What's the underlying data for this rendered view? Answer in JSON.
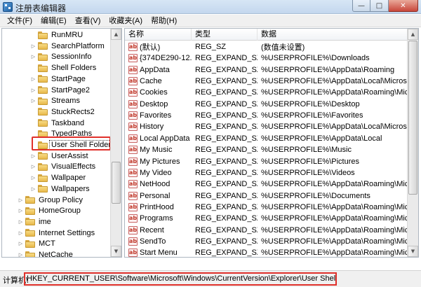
{
  "window": {
    "title": "注册表编辑器",
    "min_symbol": "—",
    "max_symbol": "□",
    "close_symbol": "✕"
  },
  "menu": [
    "文件(F)",
    "编辑(E)",
    "查看(V)",
    "收藏夹(A)",
    "帮助(H)"
  ],
  "tree": {
    "selected": "User Shell Folders",
    "items": [
      {
        "label": "RunMRU",
        "level": 2,
        "expander": false
      },
      {
        "label": "SearchPlatform",
        "level": 2,
        "expander": true
      },
      {
        "label": "SessionInfo",
        "level": 2,
        "expander": true
      },
      {
        "label": "Shell Folders",
        "level": 2,
        "expander": false
      },
      {
        "label": "StartPage",
        "level": 2,
        "expander": true
      },
      {
        "label": "StartPage2",
        "level": 2,
        "expander": true
      },
      {
        "label": "Streams",
        "level": 2,
        "expander": true
      },
      {
        "label": "StuckRects2",
        "level": 2,
        "expander": false
      },
      {
        "label": "Taskband",
        "level": 2,
        "expander": false
      },
      {
        "label": "TypedPaths",
        "level": 2,
        "expander": false
      },
      {
        "label": "User Shell Folders",
        "level": 2,
        "expander": false
      },
      {
        "label": "UserAssist",
        "level": 2,
        "expander": true
      },
      {
        "label": "VisualEffects",
        "level": 2,
        "expander": true
      },
      {
        "label": "Wallpaper",
        "level": 2,
        "expander": true
      },
      {
        "label": "Wallpapers",
        "level": 2,
        "expander": true
      },
      {
        "label": "Group Policy",
        "level": 1,
        "expander": true
      },
      {
        "label": "HomeGroup",
        "level": 1,
        "expander": true
      },
      {
        "label": "ime",
        "level": 1,
        "expander": true
      },
      {
        "label": "Internet Settings",
        "level": 1,
        "expander": true
      },
      {
        "label": "MCT",
        "level": 1,
        "expander": true
      },
      {
        "label": "NetCache",
        "level": 1,
        "expander": true
      }
    ]
  },
  "values": {
    "headers": {
      "name": "名称",
      "type": "类型",
      "data": "数据"
    },
    "rows": [
      {
        "name": "(默认)",
        "type": "REG_SZ",
        "data": "(数值未设置)"
      },
      {
        "name": "{374DE290-12...",
        "type": "REG_EXPAND_SZ",
        "data": "%USERPROFILE%\\Downloads"
      },
      {
        "name": "AppData",
        "type": "REG_EXPAND_SZ",
        "data": "%USERPROFILE%\\AppData\\Roaming"
      },
      {
        "name": "Cache",
        "type": "REG_EXPAND_SZ",
        "data": "%USERPROFILE%\\AppData\\Local\\Microsoft\\"
      },
      {
        "name": "Cookies",
        "type": "REG_EXPAND_SZ",
        "data": "%USERPROFILE%\\AppData\\Roaming\\Microsoft"
      },
      {
        "name": "Desktop",
        "type": "REG_EXPAND_SZ",
        "data": "%USERPROFILE%\\Desktop"
      },
      {
        "name": "Favorites",
        "type": "REG_EXPAND_SZ",
        "data": "%USERPROFILE%\\Favorites"
      },
      {
        "name": "History",
        "type": "REG_EXPAND_SZ",
        "data": "%USERPROFILE%\\AppData\\Local\\Microsoft\\"
      },
      {
        "name": "Local AppData",
        "type": "REG_EXPAND_SZ",
        "data": "%USERPROFILE%\\AppData\\Local"
      },
      {
        "name": "My Music",
        "type": "REG_EXPAND_SZ",
        "data": "%USERPROFILE%\\Music"
      },
      {
        "name": "My Pictures",
        "type": "REG_EXPAND_SZ",
        "data": "%USERPROFILE%\\Pictures"
      },
      {
        "name": "My Video",
        "type": "REG_EXPAND_SZ",
        "data": "%USERPROFILE%\\Videos"
      },
      {
        "name": "NetHood",
        "type": "REG_EXPAND_SZ",
        "data": "%USERPROFILE%\\AppData\\Roaming\\Microsoft"
      },
      {
        "name": "Personal",
        "type": "REG_EXPAND_SZ",
        "data": "%USERPROFILE%\\Documents"
      },
      {
        "name": "PrintHood",
        "type": "REG_EXPAND_SZ",
        "data": "%USERPROFILE%\\AppData\\Roaming\\Microsoft"
      },
      {
        "name": "Programs",
        "type": "REG_EXPAND_SZ",
        "data": "%USERPROFILE%\\AppData\\Roaming\\Microsoft"
      },
      {
        "name": "Recent",
        "type": "REG_EXPAND_SZ",
        "data": "%USERPROFILE%\\AppData\\Roaming\\Microsoft"
      },
      {
        "name": "SendTo",
        "type": "REG_EXPAND_SZ",
        "data": "%USERPROFILE%\\AppData\\Roaming\\Microsoft"
      },
      {
        "name": "Start Menu",
        "type": "REG_EXPAND_SZ",
        "data": "%USERPROFILE%\\AppData\\Roaming\\Microsoft"
      }
    ]
  },
  "status": {
    "prefix": "计算机\\",
    "path": "HKEY_CURRENT_USER\\Software\\Microsoft\\Windows\\CurrentVersion\\Explorer\\User Shell Folders"
  },
  "icons": {
    "value_icon": "string-value-icon",
    "folder": "folder-icon",
    "app": "registry-app-icon"
  },
  "colors": {
    "highlight_box": "#e0302a",
    "folder": "#e8b94a",
    "title_bar": "#c3d7ee"
  }
}
